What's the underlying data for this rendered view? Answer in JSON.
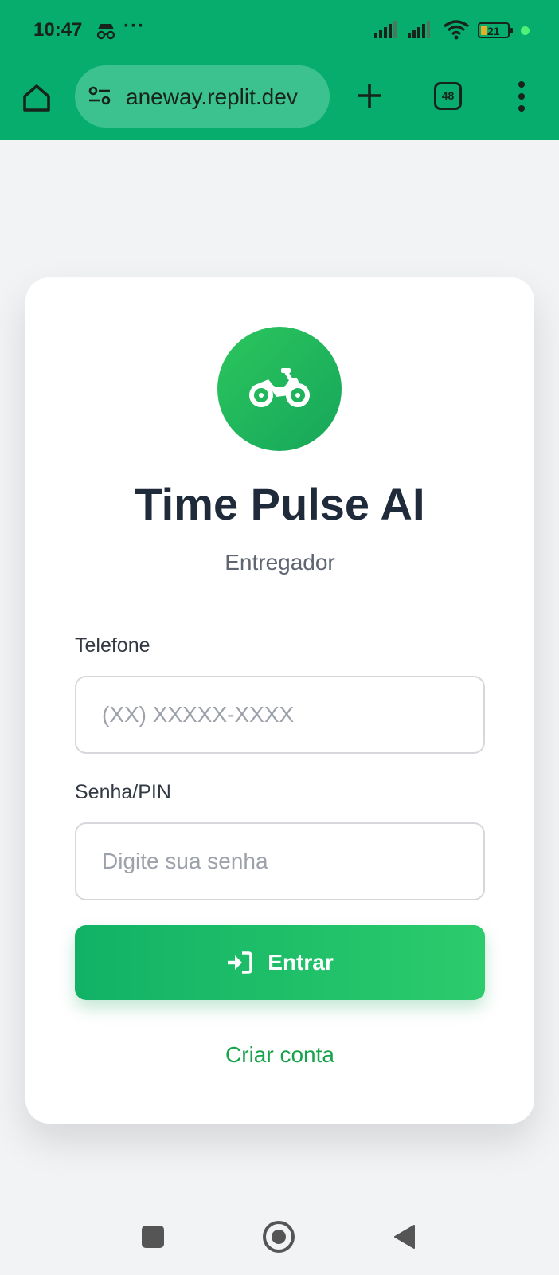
{
  "status_bar": {
    "time": "10:47",
    "more": "···",
    "battery_level": "21",
    "accent": "#06ad6c"
  },
  "browser": {
    "url": "aneway.replit.dev",
    "tab_count": "48",
    "icons": [
      "home-icon",
      "site-settings-icon",
      "plus-icon",
      "tabs-icon",
      "menu-icon"
    ]
  },
  "app": {
    "title": "Time Pulse AI",
    "subtitle": "Entregador",
    "logo_icon": "motorcycle-icon",
    "brand_color": "#16a34a"
  },
  "form": {
    "phone_label": "Telefone",
    "phone_placeholder": "(XX) XXXXX-XXXX",
    "phone_value": "",
    "password_label": "Senha/PIN",
    "password_placeholder": "Digite sua senha",
    "password_value": "",
    "login_button": "Entrar",
    "login_icon": "sign-in-icon",
    "create_account": "Criar conta"
  },
  "nav": {
    "icons": [
      "recents-icon",
      "home-circle-icon",
      "back-icon"
    ]
  }
}
